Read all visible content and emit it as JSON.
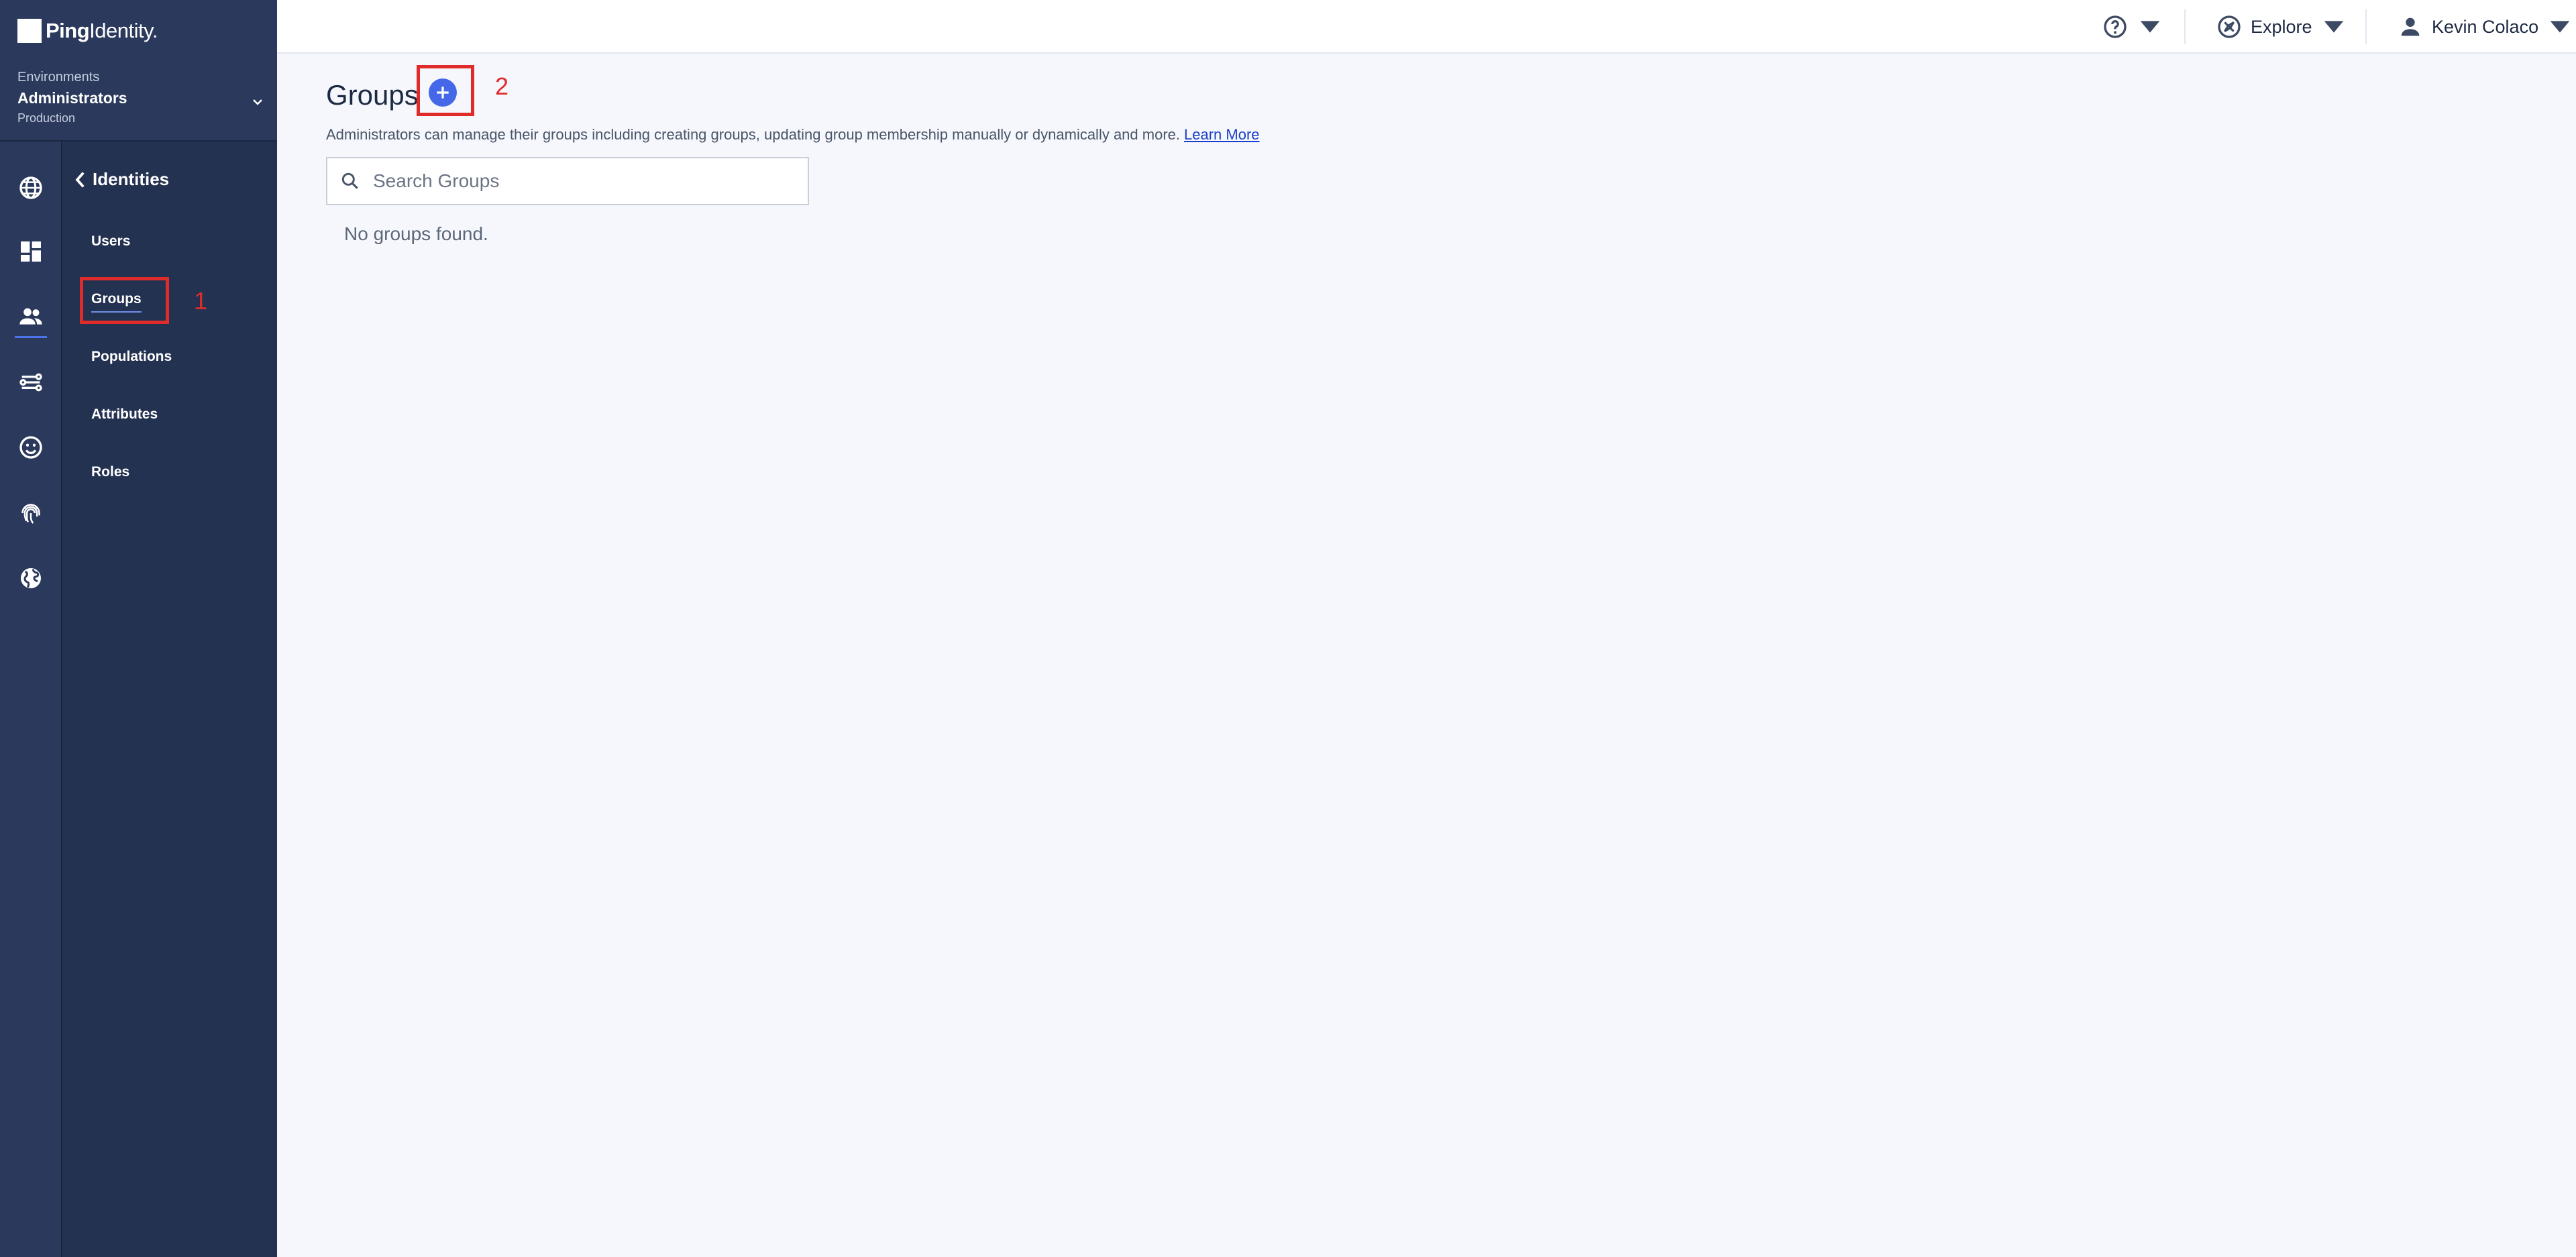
{
  "brand": {
    "logo_bold": "Ping",
    "logo_light": "Identity."
  },
  "environment": {
    "label": "Environments",
    "name": "Administrators",
    "type": "Production"
  },
  "rail_icons": [
    "globe-icon",
    "dashboard-icon",
    "users-icon",
    "connections-icon",
    "face-icon",
    "fingerprint-icon",
    "world-icon"
  ],
  "subnav": {
    "back_label": "Identities",
    "items": [
      {
        "label": "Users"
      },
      {
        "label": "Groups",
        "active": true
      },
      {
        "label": "Populations"
      },
      {
        "label": "Attributes"
      },
      {
        "label": "Roles"
      }
    ]
  },
  "topbar": {
    "explore_label": "Explore",
    "user_name": "Kevin Colaco"
  },
  "page": {
    "title": "Groups",
    "description": "Administrators can manage their groups including creating groups, updating group membership manually or dynamically and more.",
    "learn_more": "Learn More",
    "search_placeholder": "Search Groups",
    "empty_message": "No groups found."
  },
  "annotations": {
    "step1": "1",
    "step2": "2"
  },
  "colors": {
    "rail_bg": "#2b3a5c",
    "subnav_bg": "#243251",
    "accent": "#4468e8",
    "annotation": "#e02b2b"
  }
}
